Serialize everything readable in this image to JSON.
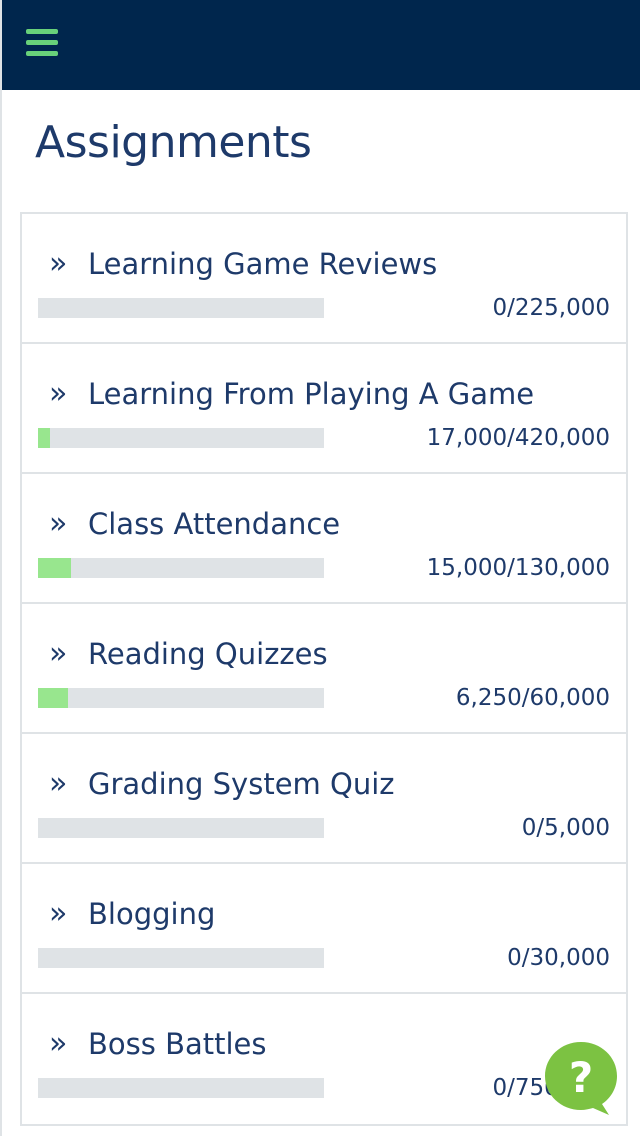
{
  "colors": {
    "header_bg": "#00264d",
    "accent_green": "#68d17a",
    "progress_fill": "#98e68e",
    "progress_track": "#dfe3e6",
    "text_navy": "#1e3a6a",
    "help_button": "#7cc242"
  },
  "header": {
    "menu_icon": "hamburger-menu-icon"
  },
  "page": {
    "title": "Assignments"
  },
  "assignments": [
    {
      "chevron": "»",
      "label": "Learning Game Reviews",
      "score": "0/225,000",
      "progress": 0
    },
    {
      "chevron": "»",
      "label": "Learning From Playing A Game",
      "score": "17,000/420,000",
      "progress": 0.0405
    },
    {
      "chevron": "»",
      "label": "Class Attendance",
      "score": "15,000/130,000",
      "progress": 0.1154
    },
    {
      "chevron": "»",
      "label": "Reading Quizzes",
      "score": "6,250/60,000",
      "progress": 0.1042
    },
    {
      "chevron": "»",
      "label": "Grading System Quiz",
      "score": "0/5,000",
      "progress": 0
    },
    {
      "chevron": "»",
      "label": "Blogging",
      "score": "0/30,000",
      "progress": 0
    },
    {
      "chevron": "»",
      "label": "Boss Battles",
      "score": "0/750,000",
      "progress": 0
    }
  ],
  "help": {
    "icon": "help-question-icon",
    "glyph": "?"
  }
}
